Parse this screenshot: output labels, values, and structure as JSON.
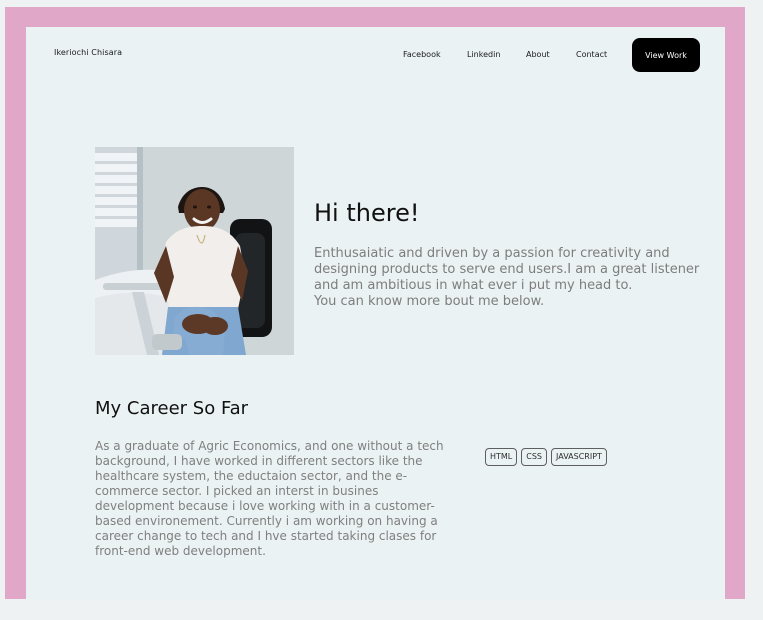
{
  "header": {
    "brand": "Ikeriochi Chisara",
    "nav": {
      "facebook": "Facebook",
      "linkedin": "Linkedin",
      "about": "About",
      "contact": "Contact"
    },
    "cta": "View Work"
  },
  "hero": {
    "title": "Hi there!",
    "body_lines": [
      "Enthusaiatic and driven by a passion for creativity and",
      "designing products to serve end users.I am a great listener",
      "and am ambitious in what ever i put my head to.",
      "You can know more bout me below."
    ]
  },
  "career": {
    "title": "My Career So Far",
    "body_lines": [
      "As a graduate of Agric Economics, and one without a tech",
      "background, I have worked in different sectors like the",
      "healthcare system, the eductaion sector, and the e-",
      "commerce sector. I picked an interst in busines",
      "development because i love working with in a customer-",
      "based environement. Currently i am working on having a",
      "career change to tech and I hve started taking clases for",
      "front-end web development."
    ],
    "skills": [
      "HTML",
      "CSS",
      "JAVASCRIPT"
    ]
  },
  "colors": {
    "frame": "#e0a7c8",
    "page": "#ebf2f3",
    "button": "#000000",
    "text": "#111111",
    "muted_text": "#7d7d7d"
  }
}
